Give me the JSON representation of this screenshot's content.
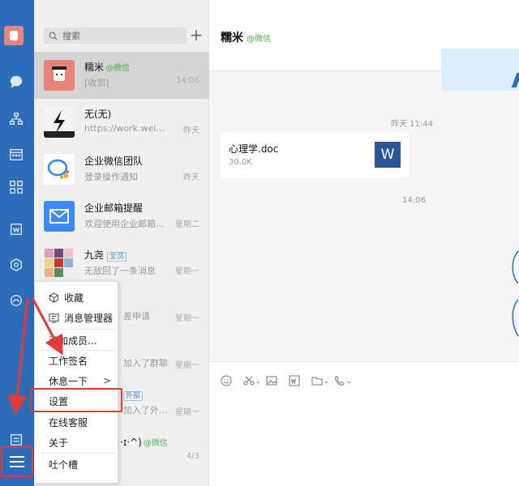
{
  "colors": {
    "rail": "#2d6cb8",
    "annotation": "#e53935",
    "accent_green": "#4caf50"
  },
  "search": {
    "placeholder": "搜索"
  },
  "add_label": "+",
  "conversations": [
    {
      "name": "糯米",
      "tag": "@微信",
      "preview": "[收到]",
      "time": "14:06",
      "avatar": "cat-avatar"
    },
    {
      "name": "无(无)",
      "preview": "https://work.weixin...",
      "time": "昨天",
      "avatar": "lightning-avatar"
    },
    {
      "name": "企业微信团队",
      "preview": "登录操作通知",
      "time": "昨天",
      "avatar": "wecom-logo"
    },
    {
      "name": "企业邮箱提醒",
      "preview": "欢迎使用企业邮箱...",
      "time": "星期二",
      "avatar": "mail-icon"
    },
    {
      "name": "九尧",
      "badge": "全员",
      "preview": "无敌回了一条消息",
      "time": "星期一",
      "avatar": "group-avatar"
    },
    {
      "preview_tail": "差申请",
      "time": "星期一"
    },
    {
      "time": ""
    },
    {
      "preview_tail": "加入了群聊",
      "time": "星期一"
    },
    {
      "name_tail": "外部",
      "preview_tail": "加入了外...",
      "time": "星期一"
    },
    {
      "name_tail": "·ɪ·^)",
      "tag": "@微信",
      "time": "4/3"
    }
  ],
  "menu": {
    "items": [
      {
        "label": "收藏",
        "icon": "cube-icon"
      },
      {
        "label": "消息管理器",
        "icon": "message-manager-icon"
      },
      {
        "label": "添加成员..."
      },
      {
        "label": "工作签名"
      },
      {
        "label": "休息一下",
        "arrow": ">"
      },
      {
        "label": "设置"
      },
      {
        "label": "在线客服"
      },
      {
        "label": "关于"
      },
      {
        "label": "吐个槽"
      }
    ]
  },
  "chat": {
    "title": "糯米",
    "title_tag": "@微信",
    "stamp_yesterday": "昨天 11:44",
    "stamp_today": "14:06",
    "file": {
      "name": "心理学.doc",
      "size": "30.0K",
      "icon_letter": "W"
    }
  }
}
